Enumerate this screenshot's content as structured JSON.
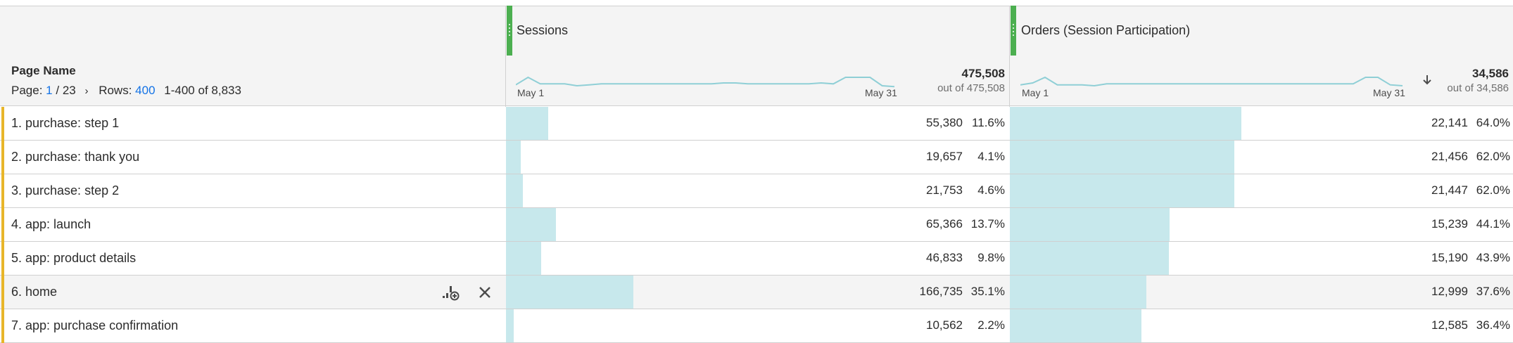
{
  "columns": {
    "sessions": {
      "title": "Sessions"
    },
    "orders": {
      "title": "Orders (Session Participation)"
    }
  },
  "dimension": {
    "title": "Page Name",
    "pager": {
      "page_label": "Page:",
      "page_current": "1",
      "page_total": "/ 23",
      "rows_label": "Rows:",
      "rows_value": "400",
      "range": "1-400 of 8,833"
    }
  },
  "summary": {
    "sessions": {
      "total": "475,508",
      "out_of": "out of 475,508",
      "start": "May 1",
      "end": "May 31",
      "trend": [
        4,
        12,
        5,
        5,
        5,
        3,
        4,
        5,
        5,
        5,
        5,
        5,
        5,
        5,
        5,
        5,
        5,
        6,
        6,
        5,
        5,
        5,
        5,
        5,
        5,
        6,
        5,
        12,
        12,
        12,
        3,
        2
      ]
    },
    "orders": {
      "total": "34,586",
      "out_of": "out of 34,586",
      "start": "May 1",
      "end": "May 31",
      "trend": [
        4,
        6,
        12,
        4,
        4,
        4,
        3,
        5,
        5,
        5,
        5,
        5,
        5,
        5,
        5,
        5,
        5,
        5,
        5,
        5,
        5,
        5,
        5,
        5,
        5,
        5,
        5,
        5,
        12,
        12,
        4,
        3
      ]
    }
  },
  "rows": [
    {
      "label": "1.  purchase: step 1",
      "sessions": "55,380",
      "sessions_pct": "11.6%",
      "sessions_frac": 0.116,
      "orders": "22,141",
      "orders_pct": "64.0%",
      "orders_frac": 0.64
    },
    {
      "label": "2.  purchase: thank you",
      "sessions": "19,657",
      "sessions_pct": "4.1%",
      "sessions_frac": 0.041,
      "orders": "21,456",
      "orders_pct": "62.0%",
      "orders_frac": 0.62
    },
    {
      "label": "3.  purchase: step 2",
      "sessions": "21,753",
      "sessions_pct": "4.6%",
      "sessions_frac": 0.046,
      "orders": "21,447",
      "orders_pct": "62.0%",
      "orders_frac": 0.62
    },
    {
      "label": "4.  app: launch",
      "sessions": "65,366",
      "sessions_pct": "13.7%",
      "sessions_frac": 0.137,
      "orders": "15,239",
      "orders_pct": "44.1%",
      "orders_frac": 0.441
    },
    {
      "label": "5.  app: product details",
      "sessions": "46,833",
      "sessions_pct": "9.8%",
      "sessions_frac": 0.098,
      "orders": "15,190",
      "orders_pct": "43.9%",
      "orders_frac": 0.439
    },
    {
      "label": "6.  home",
      "sessions": "166,735",
      "sessions_pct": "35.1%",
      "sessions_frac": 0.351,
      "orders": "12,999",
      "orders_pct": "37.6%",
      "orders_frac": 0.376
    },
    {
      "label": "7.  app: purchase confirmation",
      "sessions": "10,562",
      "sessions_pct": "2.2%",
      "sessions_frac": 0.022,
      "orders": "12,585",
      "orders_pct": "36.4%",
      "orders_frac": 0.364
    }
  ],
  "row_actions": {
    "hover_row": 5,
    "icons": [
      "breakdown-icon",
      "close-icon"
    ]
  },
  "colors": {
    "bar": "#c7e8ec",
    "sparkline": "#8fcfd6",
    "stripe": "#e8b62a",
    "handle": "#4caf50",
    "link": "#1473e6"
  }
}
